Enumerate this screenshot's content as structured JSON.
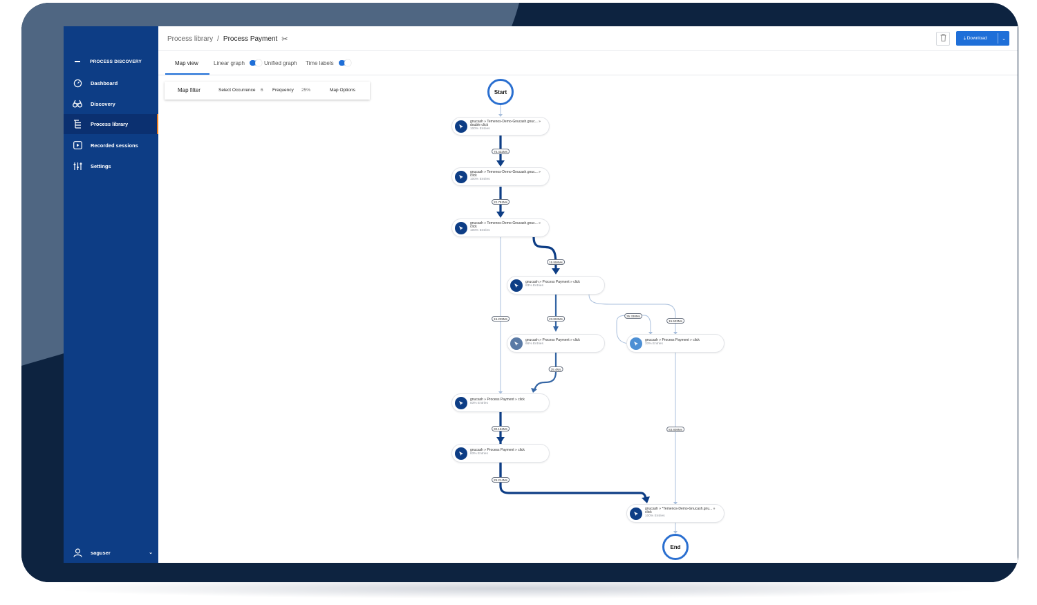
{
  "sidebar": {
    "header": "PROCESS DISCOVERY",
    "items": [
      {
        "label": "Dashboard",
        "icon": "speedometer-icon"
      },
      {
        "label": "Discovery",
        "icon": "binoculars-icon"
      },
      {
        "label": "Process library",
        "icon": "tree-list-icon"
      },
      {
        "label": "Recorded sessions",
        "icon": "play-icon"
      },
      {
        "label": "Settings",
        "icon": "sliders-icon"
      }
    ],
    "user": "saguser"
  },
  "header": {
    "breadcrumb_root": "Process library",
    "breadcrumb_sep": "/",
    "breadcrumb_current": "Process Payment",
    "download_label": "Download"
  },
  "tabs": {
    "map_view": "Map view",
    "linear_graph": "Linear graph",
    "unified_graph": "Unified graph",
    "time_labels": "Time labels"
  },
  "map_filter": {
    "title": "Map filter",
    "occurrence_label": "Select Occurrence",
    "occurrence_value": "6",
    "frequency_label": "Frequency",
    "frequency_value": "25%",
    "options_label": "Map Options"
  },
  "graph": {
    "start": "Start",
    "end": "End",
    "nodes": [
      {
        "line1": "gnucash » Temenos-Demo-Gnucash.gnuc... »",
        "line2": "double click",
        "entries": "100% Entries"
      },
      {
        "line1": "gnucash » Temenos-Demo-Gnucash.gnuc... »",
        "line2": "click",
        "entries": "100% Entries"
      },
      {
        "line1": "gnucash » Temenos-Demo-Gnucash.gnuc... »",
        "line2": "click",
        "entries": "100% Entries"
      },
      {
        "line1": "gnucash » Process Payment » click",
        "line2": "",
        "entries": "83% Entries"
      },
      {
        "line1": "gnucash » Process Payment » click",
        "line2": "",
        "entries": "66% Entries"
      },
      {
        "line1": "gnucash » Process Payment » click",
        "line2": "",
        "entries": "33% Entries"
      },
      {
        "line1": "gnucash » Process Payment » click",
        "line2": "",
        "entries": "83% Entries"
      },
      {
        "line1": "gnucash » Process Payment » click",
        "line2": "",
        "entries": "83% Entries"
      },
      {
        "line1": "gnucash » *Temenos-Demo-Gnucash.gnu... »",
        "line2": "click",
        "entries": "100% Entries"
      }
    ],
    "edge_labels": [
      "75.432Ms",
      "22.791Ms",
      "15.858Ms",
      "15.239Ms",
      "23.804Ms",
      "35.338Ms",
      "15.533Ms",
      "25.4Ms",
      "30.162Ms",
      "83.808Ms",
      "25.214Ms"
    ]
  },
  "colors": {
    "sidebar": "#0d3d85",
    "accent": "#1f6fd8",
    "frame": "#0d2340",
    "edge_dark": "#0d3d85",
    "edge_light": "#a9bfdc"
  }
}
